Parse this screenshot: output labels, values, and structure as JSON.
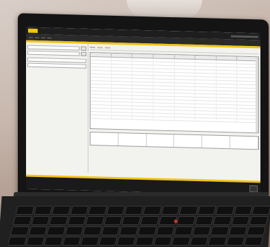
{
  "colors": {
    "accent": "#f1c40f",
    "chrome": "#1e1e1e",
    "screen_bg": "#f2f2ef"
  },
  "app": {
    "title": "",
    "menu": [
      "",
      "",
      "",
      ""
    ]
  },
  "left_panel": {
    "sections": [
      {
        "header": "",
        "rows": 2
      },
      {
        "header": "",
        "rows": 2
      },
      {
        "header": "",
        "rows": 1
      }
    ],
    "grid_values": [
      "",
      "",
      "",
      "",
      "",
      "",
      "",
      "",
      "",
      "",
      "",
      ""
    ]
  },
  "ribbon": {
    "tabs": [
      "",
      "",
      ""
    ]
  },
  "table": {
    "columns": [
      "",
      "",
      "",
      "",
      "",
      "",
      "",
      ""
    ],
    "row_count": 18
  },
  "bottom_table": {
    "columns": [
      "",
      "",
      "",
      "",
      "",
      ""
    ]
  },
  "status_bar": {
    "text": ""
  }
}
